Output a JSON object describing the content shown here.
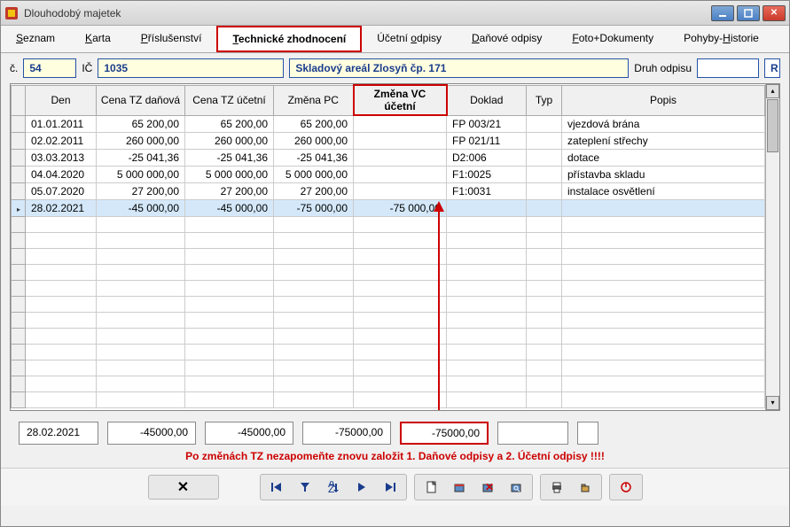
{
  "window": {
    "title": "Dlouhodobý majetek"
  },
  "tabs": [
    {
      "label": "Seznam",
      "ul": "S"
    },
    {
      "label": "Karta",
      "ul": "K"
    },
    {
      "label": "Příslušenství",
      "ul": "P"
    },
    {
      "label": "Technické zhodnocení",
      "ul": "T"
    },
    {
      "label": "Účetní odpisy",
      "ul": "o"
    },
    {
      "label": "Daňové odpisy",
      "ul": "D"
    },
    {
      "label": "Foto+Dokumenty",
      "ul": "F"
    },
    {
      "label": "Pohyby-Historie",
      "ul": "H"
    }
  ],
  "header": {
    "c_label": "č.",
    "c_value": "54",
    "ic_label": "IČ",
    "ic_value": "1035",
    "name_value": "Skladový areál Zlosyň čp. 171",
    "druh_label": "Druh odpisu",
    "druh_value": "R"
  },
  "columns": [
    "Den",
    "Cena TZ daňová",
    "Cena TZ účetní",
    "Změna PC",
    "Změna VC účetní",
    "Doklad",
    "Typ",
    "Popis"
  ],
  "hl_col_index": 4,
  "rows": [
    {
      "den": "01.01.2011",
      "ctzd": "65 200,00",
      "ctzu": "65 200,00",
      "zpc": "65 200,00",
      "zvc": "",
      "dok": "FP 003/21",
      "typ": "",
      "pop": "vjezdová brána"
    },
    {
      "den": "02.02.2011",
      "ctzd": "260 000,00",
      "ctzu": "260 000,00",
      "zpc": "260 000,00",
      "zvc": "",
      "dok": "FP 021/11",
      "typ": "",
      "pop": "zateplení střechy"
    },
    {
      "den": "03.03.2013",
      "ctzd": "-25 041,36",
      "ctzu": "-25 041,36",
      "zpc": "-25 041,36",
      "zvc": "",
      "dok": "D2:006",
      "typ": "",
      "pop": "dotace"
    },
    {
      "den": "04.04.2020",
      "ctzd": "5 000 000,00",
      "ctzu": "5 000 000,00",
      "zpc": "5 000 000,00",
      "zvc": "",
      "dok": "F1:0025",
      "typ": "",
      "pop": "přístavba skladu"
    },
    {
      "den": "05.07.2020",
      "ctzd": "27 200,00",
      "ctzu": "27 200,00",
      "zpc": "27 200,00",
      "zvc": "",
      "dok": "F1:0031",
      "typ": "",
      "pop": "instalace osvětlení"
    },
    {
      "den": "28.02.2021",
      "ctzd": "-45 000,00",
      "ctzu": "-45 000,00",
      "zpc": "-75 000,00",
      "zvc": "-75 000,00",
      "dok": "",
      "typ": "",
      "pop": ""
    }
  ],
  "selected_row": 5,
  "edit": {
    "date": "28.02.2021",
    "v1": "-45000,00",
    "v2": "-45000,00",
    "v3": "-75000,00",
    "v4": "-75000,00",
    "v5": "",
    "v6": ""
  },
  "note": "Po změnách TZ nezapomeňte znovu založit 1. Daňové odpisy a 2. Účetní odpisy !!!!"
}
